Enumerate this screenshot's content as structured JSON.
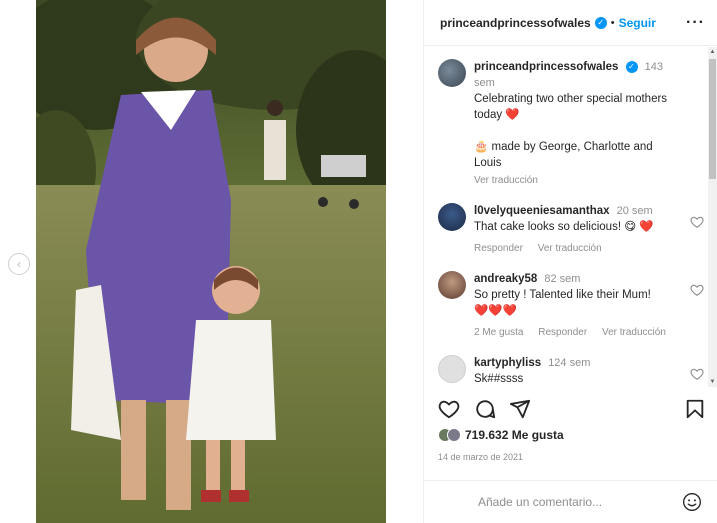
{
  "post": {
    "username": "princeandprincessofwales",
    "follow_label": "Seguir",
    "more_icon": "more-horizontal-icon"
  },
  "comments": [
    {
      "username": "princeandprincessofwales",
      "time": "143 sem",
      "text1": "Celebrating two other special mothers today",
      "emoji1": "❤️",
      "text2": "made by George, Charlotte and Louis",
      "cake_emoji": "🎂",
      "translate": "Ver traducción"
    },
    {
      "username": "l0velyqueeniesamanthax",
      "time": "20 sem",
      "text": "That cake looks so delicious!",
      "emoji": "😋 ❤️",
      "reply": "Responder",
      "translate": "Ver traducción"
    },
    {
      "username": "andreaky58",
      "time": "82 sem",
      "text": "So pretty ! Talented like their Mum!",
      "emoji": "❤️❤️❤️",
      "likes": "2 Me gusta",
      "reply": "Responder",
      "translate": "Ver traducción"
    },
    {
      "username": "kartyphyliss",
      "time": "124 sem",
      "text": "Sk##ssss"
    }
  ],
  "likes_count": "719.632 Me gusta",
  "date": "14 de marzo de 2021",
  "add_comment_placeholder": "Añade un comentario...",
  "colors": {
    "accent": "#0095f6",
    "heart": "#ed4956",
    "muted": "#8e8e8e"
  }
}
